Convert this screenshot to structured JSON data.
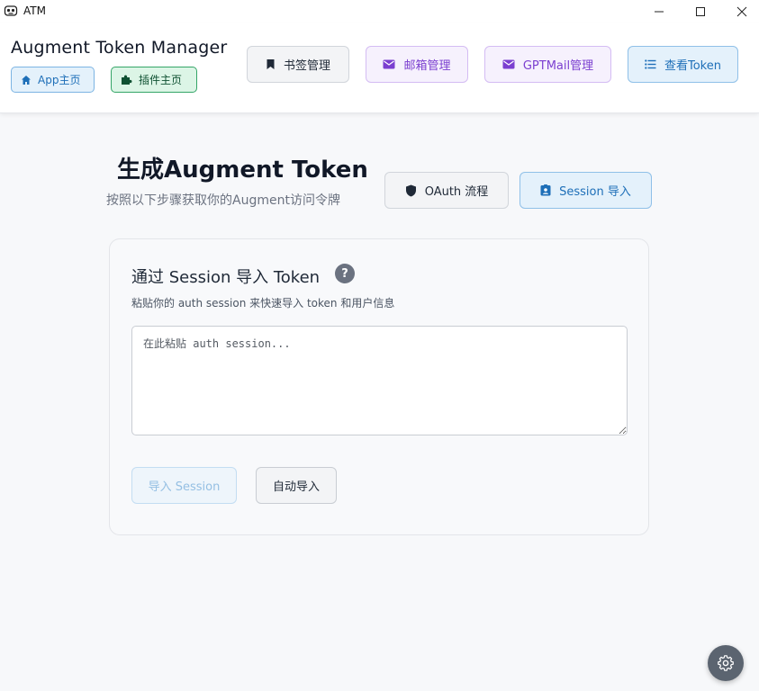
{
  "window": {
    "title": "ATM",
    "controls": {
      "minimize": "minimize",
      "maximize": "maximize",
      "close": "close"
    }
  },
  "header": {
    "brand": "Augment Token Manager",
    "links": {
      "app_home": {
        "label": "App主页",
        "icon": "home-icon"
      },
      "plugin_home": {
        "label": "插件主页",
        "icon": "puzzle-icon"
      }
    },
    "nav": {
      "bookmarks": {
        "label": "书签管理",
        "icon": "bookmark-icon"
      },
      "mailbox": {
        "label": "邮箱管理",
        "icon": "mail-icon"
      },
      "gptmail": {
        "label": "GPTMail管理",
        "icon": "mail-icon"
      },
      "view_token": {
        "label": "查看Token",
        "icon": "list-icon"
      }
    }
  },
  "main": {
    "title": "生成Augment Token",
    "subtitle": "按照以下步骤获取你的Augment访问令牌",
    "modes": {
      "oauth": {
        "label": "OAuth 流程",
        "icon": "shield-icon"
      },
      "session": {
        "label": "Session 导入",
        "icon": "id-badge-icon"
      }
    },
    "card": {
      "title": "通过 Session 导入 Token",
      "help": "?",
      "description": "粘贴你的 auth session 来快速导入 token 和用户信息",
      "input_value": "",
      "input_placeholder": "在此粘贴 auth session...",
      "import_button": "导入 Session",
      "auto_button": "自动导入"
    }
  },
  "settings": {
    "icon": "gear-icon"
  },
  "colors": {
    "accent_blue": "#1e6fb8",
    "accent_purple": "#7b3fd0",
    "accent_green": "#0f5132",
    "background": "#f7f8fa"
  }
}
